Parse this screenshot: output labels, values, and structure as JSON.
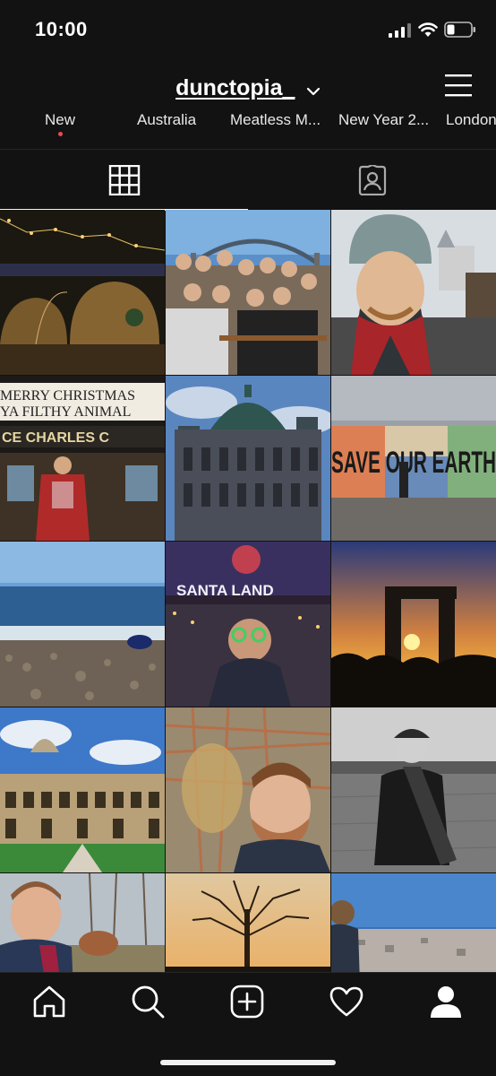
{
  "status_bar": {
    "time": "10:00"
  },
  "header": {
    "username": "dunctopia_"
  },
  "highlights": [
    "New",
    "Australia",
    "Meatless M...",
    "New Year 2...",
    "London"
  ],
  "tabs": {
    "grid_icon": "grid-icon",
    "tagged_icon": "tagged-person-icon"
  },
  "photos": [
    {
      "label": "MERRY CHRISTMAS",
      "sub": "YA FILTHY ANIMAL"
    },
    {
      "label": "CE CHARLES C"
    },
    {
      "label": "SAVE OUR EARTH"
    },
    {
      "label": "SANTA LAND"
    }
  ],
  "nav": [
    "home-icon",
    "search-icon",
    "new-post-icon",
    "activity-heart-icon",
    "profile-icon"
  ],
  "colors": {
    "background": "#121212",
    "accent_dot": "#ed4956"
  }
}
